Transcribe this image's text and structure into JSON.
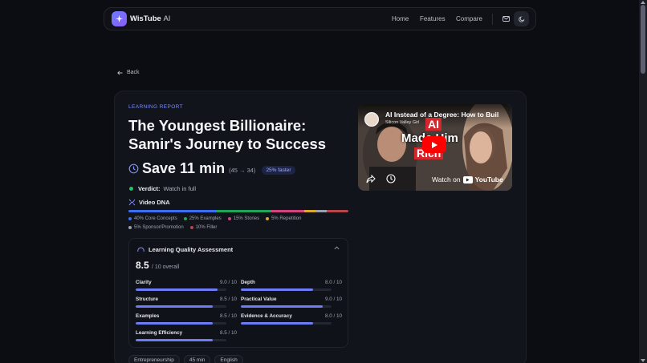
{
  "nav": {
    "brand": "WisTube",
    "brand_suffix": "AI",
    "links": [
      "Home",
      "Features",
      "Compare"
    ],
    "icons": [
      "mail-icon",
      "moon-icon"
    ]
  },
  "back_label": "Back",
  "report": {
    "eyebrow": "LEARNING REPORT",
    "title": "The Youngest Billionaire: Samir's Journey to Success",
    "save_label": "Save 11 min",
    "save_detail": "(45 → 34)",
    "faster_badge": "25% faster",
    "verdict_label": "Verdict:",
    "verdict_value": "Watch in full",
    "dna_title": "Video DNA",
    "dna_segments": [
      {
        "label": "40% Core Concepts",
        "pct": 40,
        "color": "#3b6ef0"
      },
      {
        "label": "25% Examples",
        "pct": 25,
        "color": "#22a35a"
      },
      {
        "label": "15% Stories",
        "pct": 15,
        "color": "#d0457f"
      },
      {
        "label": "5% Repetition",
        "pct": 5,
        "color": "#d9a72b"
      },
      {
        "label": "5% Sponsor/Promotion",
        "pct": 5,
        "color": "#9aa0ad"
      },
      {
        "label": "10% Filler",
        "pct": 10,
        "color": "#b8454a"
      }
    ]
  },
  "video": {
    "title": "AI Instead of a Degree: How to Buil",
    "channel": "Silicon Valley Girl",
    "overlay_top": "AI",
    "overlay_mid": "Made Him",
    "overlay_bot": "Rich",
    "watch_on": "Watch on",
    "youtube": "YouTube"
  },
  "quality": {
    "title": "Learning Quality Assessment",
    "score": "8.5",
    "score_sub": "/ 10 overall",
    "metrics": [
      {
        "name": "Clarity",
        "score": "9.0 / 10",
        "value": 9.0
      },
      {
        "name": "Depth",
        "score": "8.0 / 10",
        "value": 8.0
      },
      {
        "name": "Structure",
        "score": "8.5 / 10",
        "value": 8.5
      },
      {
        "name": "Practical Value",
        "score": "9.0 / 10",
        "value": 9.0
      },
      {
        "name": "Examples",
        "score": "8.5 / 10",
        "value": 8.5
      },
      {
        "name": "Evidence & Accuracy",
        "score": "8.0 / 10",
        "value": 8.0
      },
      {
        "name": "Learning Efficiency",
        "score": "8.5 / 10",
        "value": 8.5
      }
    ]
  },
  "tags": [
    "Entrepreneurship",
    "45 min",
    "English"
  ],
  "colors": {
    "accent": "#6e7cf6",
    "verdict_dot": "#22c55e"
  }
}
